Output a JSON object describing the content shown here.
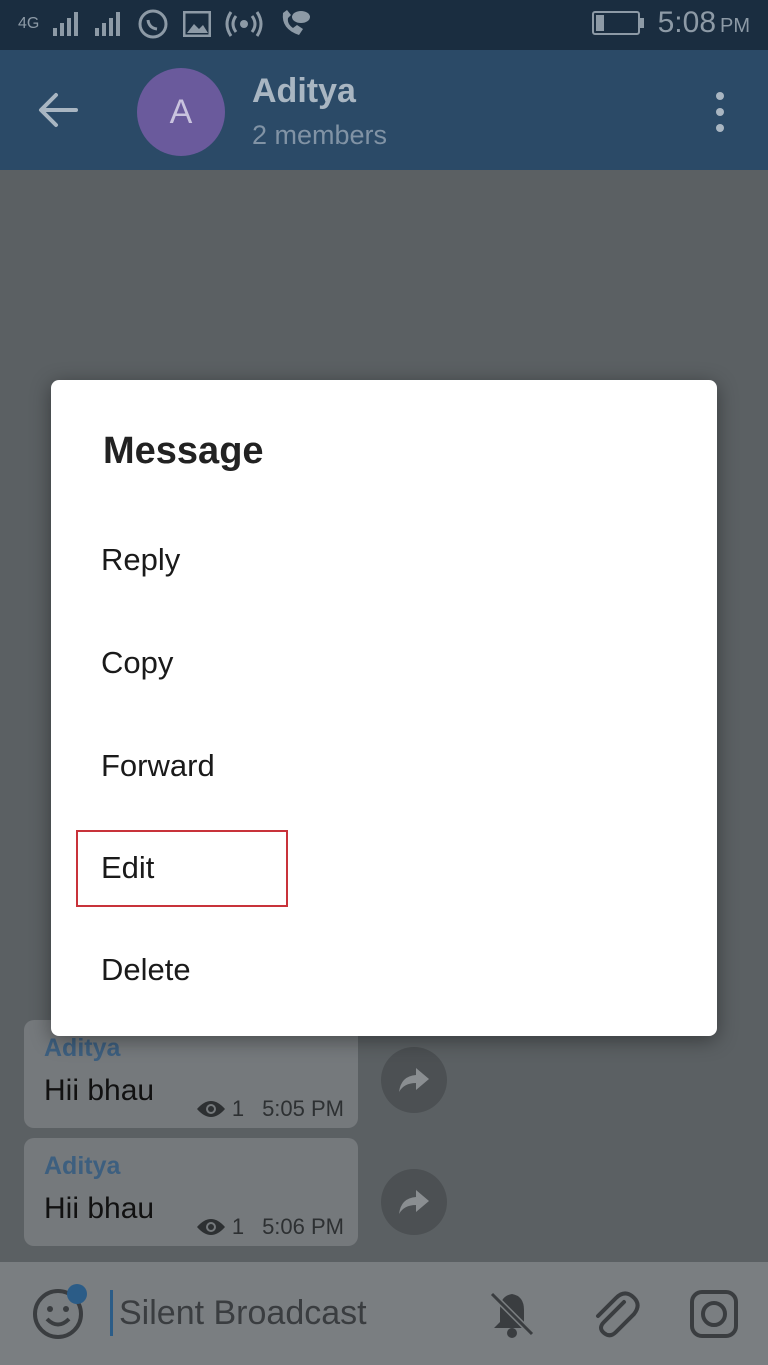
{
  "status_bar": {
    "network": "4G",
    "time": "5:08",
    "ampm": "PM"
  },
  "header": {
    "avatar_letter": "A",
    "title": "Aditya",
    "subtitle": "2 members"
  },
  "messages": [
    {
      "sender": "Aditya",
      "text": "Hii bhau",
      "views": "1",
      "time": "5:05 PM"
    },
    {
      "sender": "Aditya",
      "text": "Hii bhau",
      "views": "1",
      "time": "5:06 PM"
    }
  ],
  "input": {
    "placeholder": "Silent Broadcast"
  },
  "dialog": {
    "title": "Message",
    "items": [
      "Reply",
      "Copy",
      "Forward",
      "Edit",
      "Delete"
    ]
  },
  "colors": {
    "header_bg": "#2b4a67",
    "avatar": "#6a5a9c",
    "highlight": "#c8323a"
  }
}
